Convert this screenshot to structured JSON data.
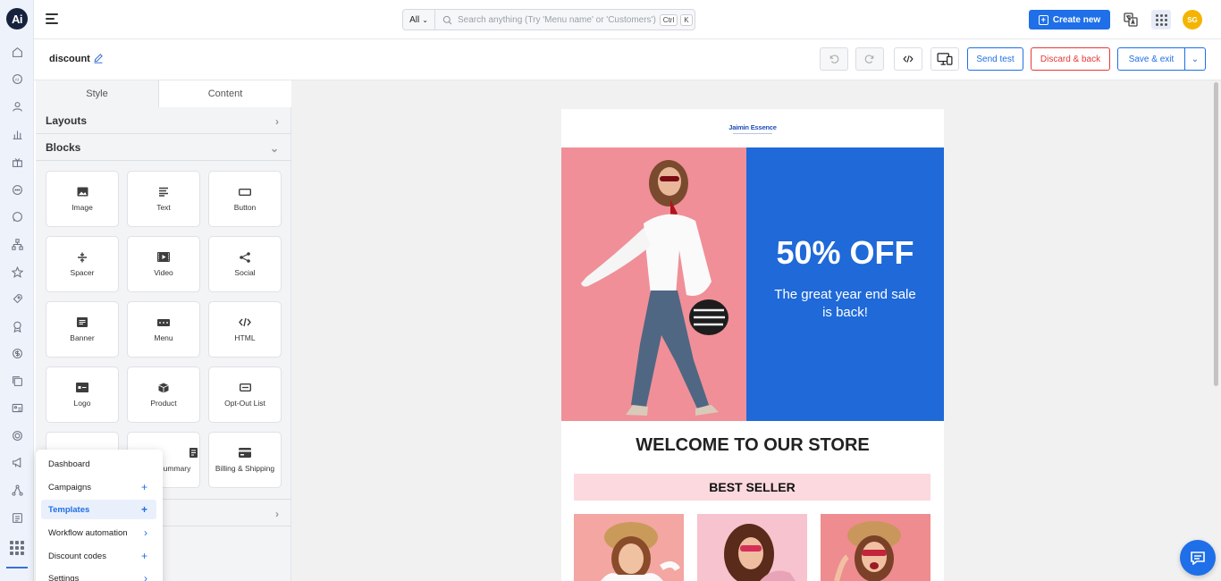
{
  "app": {
    "logo_text": "Ai",
    "avatar_initials": "SG"
  },
  "search": {
    "scope": "All",
    "placeholder": "Search anything (Try 'Menu name' or 'Customers')",
    "key1": "Ctrl",
    "key2": "K"
  },
  "header": {
    "create_label": "Create new"
  },
  "editor": {
    "template_name": "discount",
    "send_test": "Send test",
    "discard": "Discard & back",
    "save_exit": "Save & exit"
  },
  "panel": {
    "tabs": [
      "Style",
      "Content"
    ],
    "active_tab": "Content",
    "layouts_label": "Layouts",
    "blocks_label": "Blocks",
    "blocks": [
      {
        "label": "Image",
        "icon": "image-icon"
      },
      {
        "label": "Text",
        "icon": "text-icon"
      },
      {
        "label": "Button",
        "icon": "button-icon"
      },
      {
        "label": "Spacer",
        "icon": "spacer-icon"
      },
      {
        "label": "Video",
        "icon": "video-icon"
      },
      {
        "label": "Social",
        "icon": "share-icon"
      },
      {
        "label": "Banner",
        "icon": "banner-icon"
      },
      {
        "label": "Menu",
        "icon": "menu-icon"
      },
      {
        "label": "HTML",
        "icon": "code-icon"
      },
      {
        "label": "Logo",
        "icon": "logo-icon"
      },
      {
        "label": "Product",
        "icon": "box-icon"
      },
      {
        "label": "Opt-Out List",
        "icon": "list-icon"
      },
      {
        "label": "",
        "icon": ""
      },
      {
        "label": "ummary",
        "icon": "summary-icon"
      },
      {
        "label": "Billing & Shipping",
        "icon": "card-icon"
      }
    ]
  },
  "popup_menu": {
    "items": [
      {
        "label": "Dashboard",
        "side": ""
      },
      {
        "label": "Campaigns",
        "side": "+"
      },
      {
        "label": "Templates",
        "side": "+",
        "active": true
      },
      {
        "label": "Workflow automation",
        "side": "›"
      },
      {
        "label": "Discount codes",
        "side": "+"
      },
      {
        "label": "Settings",
        "side": "›"
      }
    ]
  },
  "email": {
    "brand": "Jaimin Essence",
    "hero_title": "50% OFF",
    "hero_subtitle": "The great year end sale is back!",
    "welcome": "WELCOME TO OUR STORE",
    "section_title": "BEST SELLER"
  },
  "colors": {
    "accent": "#1e6fe8",
    "danger": "#e53935",
    "hero_blue": "#1f69d8",
    "hero_pink": "#f08f98",
    "banner_pink": "#fbd9de",
    "avatar": "#f4b400"
  },
  "rail_icons": [
    "home-icon",
    "ai-icon",
    "user-icon",
    "chart-icon",
    "gift-icon",
    "chat-icon",
    "whatsapp-icon",
    "hierarchy-icon",
    "star-icon",
    "rocket-icon",
    "badge-icon",
    "dollar-icon",
    "copy-icon",
    "image-card-icon",
    "target-icon",
    "megaphone-icon",
    "network-icon",
    "report-icon",
    "apps-icon"
  ]
}
